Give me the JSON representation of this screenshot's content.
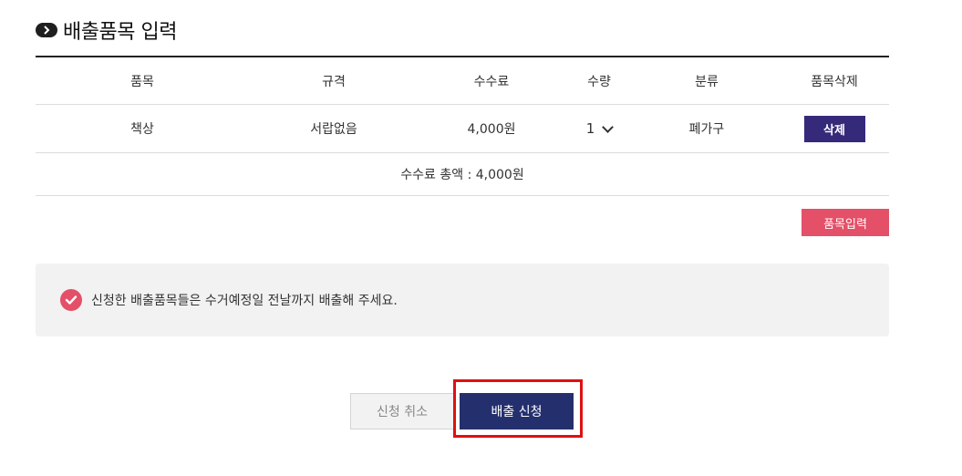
{
  "page": {
    "title": "배출품목 입력",
    "title_icon": "chevron-right-icon"
  },
  "table": {
    "headers": [
      "품목",
      "규격",
      "수수료",
      "수량",
      "분류",
      "품목삭제"
    ],
    "rows": [
      {
        "item": "책상",
        "spec": "서랍없음",
        "fee": "4,000원",
        "quantity": "1",
        "category": "폐가구",
        "delete_label": "삭제"
      }
    ],
    "total": "수수료 총액 : 4,000원"
  },
  "add_item_label": "품목입력",
  "notice": {
    "icon": "check-circle-icon",
    "text": "신청한 배출품목들은 수거예정일 전날까지 배출해 주세요."
  },
  "actions": {
    "cancel_label": "신청 취소",
    "submit_label": "배출 신청"
  },
  "colors": {
    "accent_pink": "#e35068",
    "delete_purple": "#352a7a",
    "submit_navy": "#24306e",
    "highlight_red": "#e01010"
  }
}
